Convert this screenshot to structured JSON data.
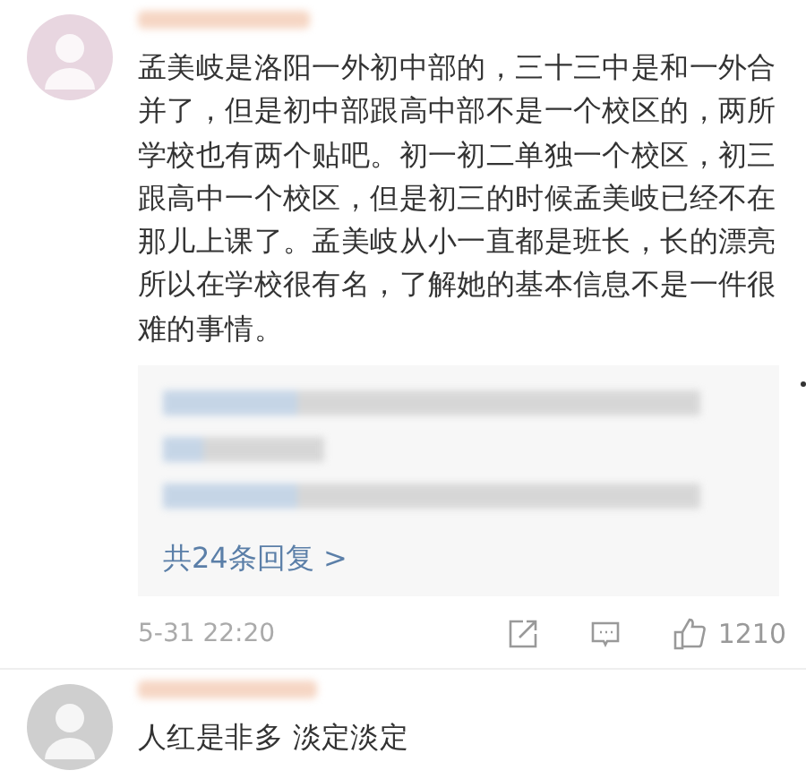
{
  "comments": [
    {
      "text": "孟美岐是洛阳一外初中部的，三十三中是和一外合并了，但是初中部跟高中部不是一个校区的，两所学校也有两个贴吧。初一初二单独一个校区，初三跟高中一个校区，但是初三的时候孟美岐已经不在那儿上课了。孟美岐从小一直都是班长，长的漂亮所以在学校很有名，了解她的基本信息不是一件很难的事情。",
      "replies": {
        "link": "共24条回复 >"
      },
      "time": "5-31 22:20",
      "likes": "1210"
    },
    {
      "text": "人红是非多 淡定淡定"
    }
  ]
}
